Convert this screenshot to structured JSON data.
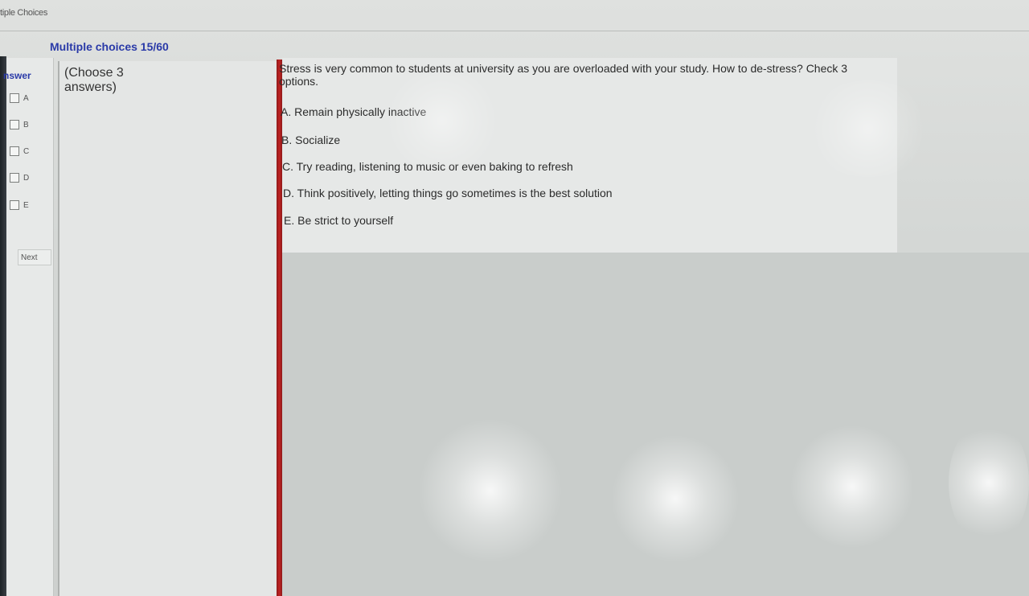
{
  "window": {
    "title": "tiple Choices"
  },
  "header": {
    "section_title": "Multiple choices 15/60"
  },
  "answer_panel": {
    "header": "nswer",
    "options": [
      {
        "letter": "A"
      },
      {
        "letter": "B"
      },
      {
        "letter": "C"
      },
      {
        "letter": "D"
      },
      {
        "letter": "E"
      }
    ],
    "next_label": "Next"
  },
  "instruction": {
    "text": "(Choose 3 answers)"
  },
  "question": {
    "prompt": "Stress is very common to students at university as you are overloaded with your study. How to de-stress? Check 3 options.",
    "choices": [
      {
        "text": "A. Remain physically inactive"
      },
      {
        "text": "B. Socialize"
      },
      {
        "text": "C. Try reading, listening to music or even baking to refresh"
      },
      {
        "text": "D. Think positively, letting things go sometimes is the best solution"
      },
      {
        "text": "E. Be strict to yourself"
      }
    ]
  }
}
